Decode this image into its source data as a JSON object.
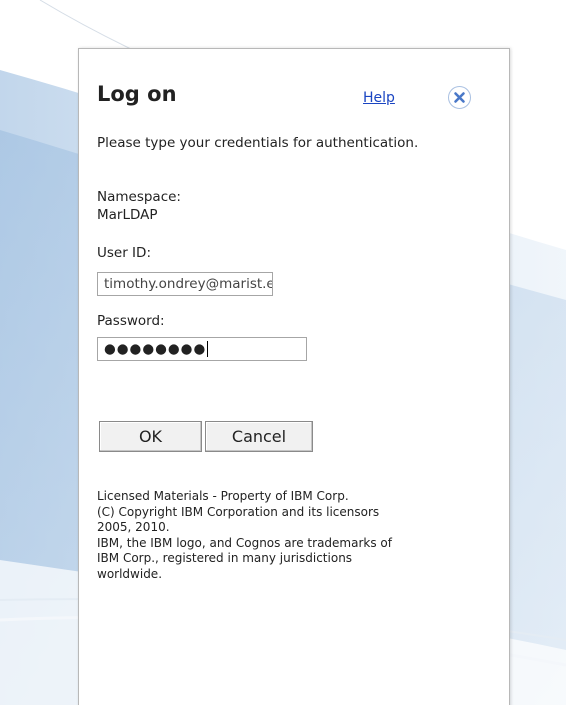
{
  "dialog": {
    "title": "Log on",
    "help_label": "Help",
    "close_icon": "close-icon",
    "intro": "Please type your credentials for authentication."
  },
  "namespace": {
    "label": "Namespace:",
    "value": "MarLDAP"
  },
  "user_id": {
    "label": "User ID:",
    "value": "timothy.ondrey@marist.e"
  },
  "password": {
    "label": "Password:",
    "masked_value": "●●●●●●●●"
  },
  "buttons": {
    "ok_label": "OK",
    "cancel_label": "Cancel"
  },
  "legal": {
    "lines": [
      "Licensed Materials - Property of IBM Corp.",
      "(C) Copyright IBM Corporation and its licensors",
      "2005, 2010.",
      "IBM, the IBM logo, and Cognos are trademarks of",
      "IBM Corp., registered in many jurisdictions",
      "worldwide."
    ]
  },
  "colors": {
    "link": "#1a45c2",
    "close_x": "#4a78c8",
    "background_swoosh": "#c9dcee"
  }
}
